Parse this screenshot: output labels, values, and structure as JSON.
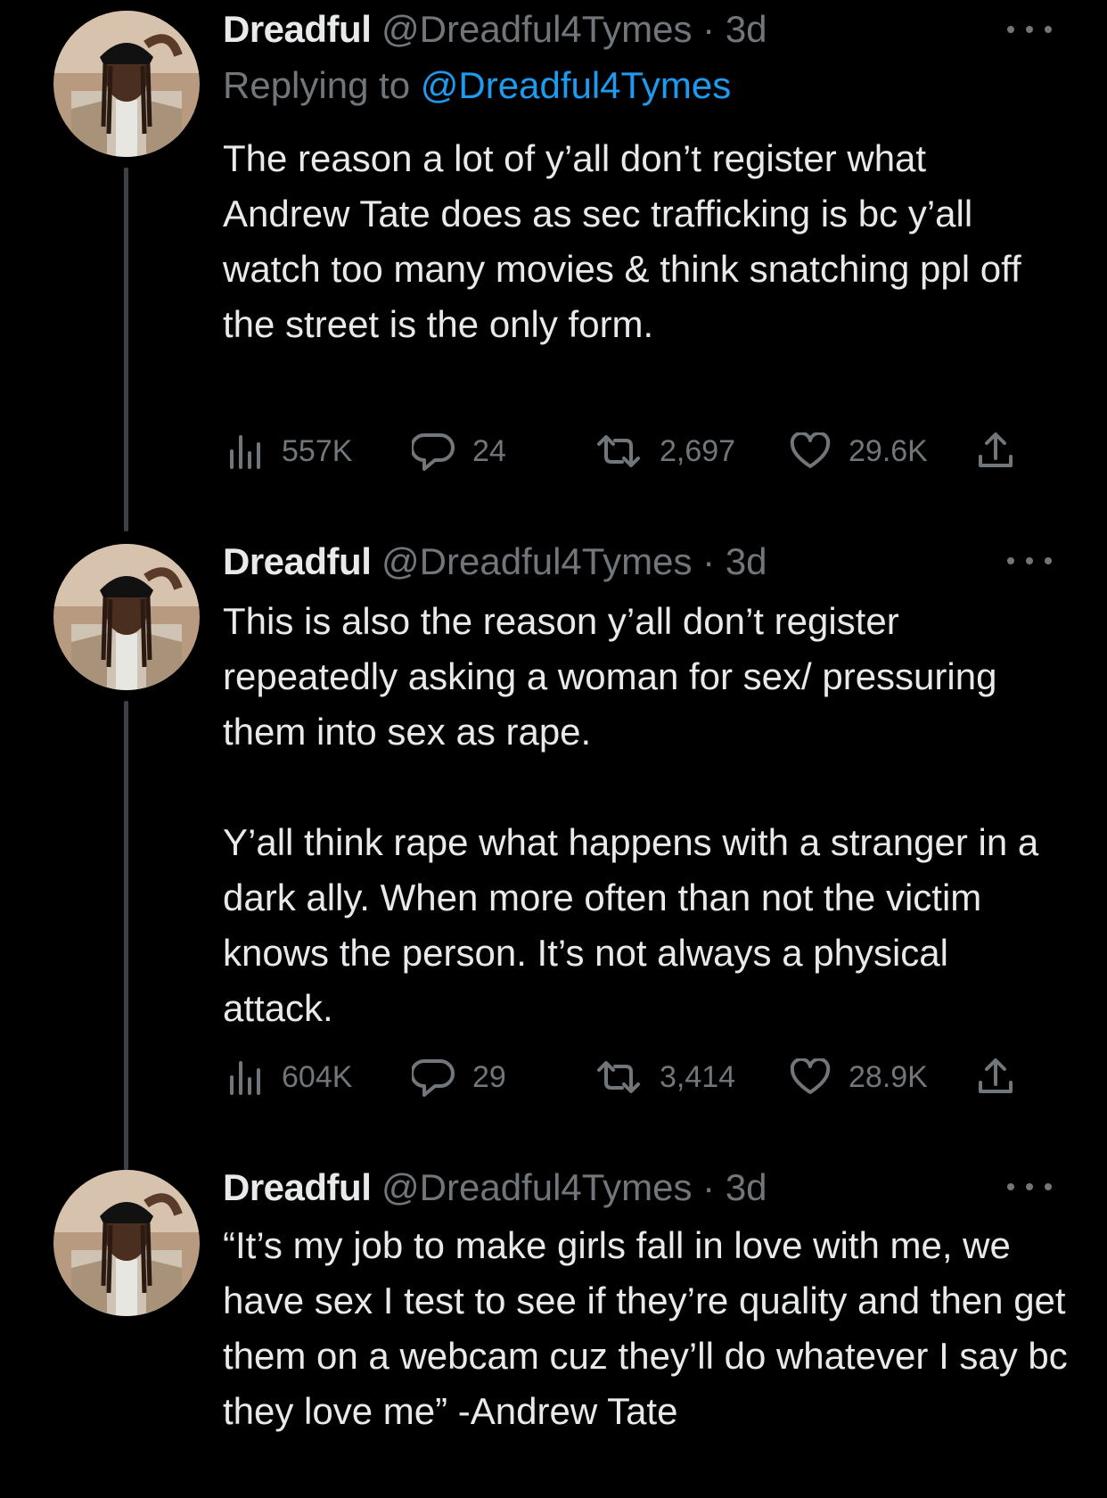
{
  "tweets": [
    {
      "name": "Dreadful",
      "handle": "@Dreadful4Tymes",
      "separator": "·",
      "time": "3d",
      "replying_label": "Replying to",
      "replying_to": "@Dreadful4Tymes",
      "text": [
        "The reason a lot of y’all don’t register what Andrew Tate does as sec trafficking is bc y’all watch too many movies & think snatching ppl off the street is the only form."
      ],
      "views": "557K",
      "replies": "24",
      "retweets": "2,697",
      "likes": "29.6K"
    },
    {
      "name": "Dreadful",
      "handle": "@Dreadful4Tymes",
      "separator": "·",
      "time": "3d",
      "text": [
        "This is also the reason y’all don’t register repeatedly asking a woman for sex/ pressuring them into sex as rape.",
        "Y’all think rape what happens with a stranger in a dark ally. When more often than not the victim knows the person. It’s not always a physical attack."
      ],
      "views": "604K",
      "replies": "29",
      "retweets": "3,414",
      "likes": "28.9K"
    },
    {
      "name": "Dreadful",
      "handle": "@Dreadful4Tymes",
      "separator": "·",
      "time": "3d",
      "text": [
        "“It’s my job to make girls fall in love with me, we have sex I test to see if they’re quality and then get them on a webcam cuz they’ll do whatever I say bc they love me” -Andrew Tate"
      ]
    }
  ],
  "icons": {
    "avatar": "profile-photo",
    "more": "more-dots-icon",
    "views": "analytics-bars-icon",
    "reply": "speech-bubble-icon",
    "retweet": "retweet-arrows-icon",
    "like": "heart-icon",
    "share": "share-upload-icon"
  },
  "colors": {
    "background": "#000000",
    "text": "#e7e9ea",
    "muted": "#71767b",
    "link": "#1d9bf0",
    "thread_line": "#3e4144"
  }
}
